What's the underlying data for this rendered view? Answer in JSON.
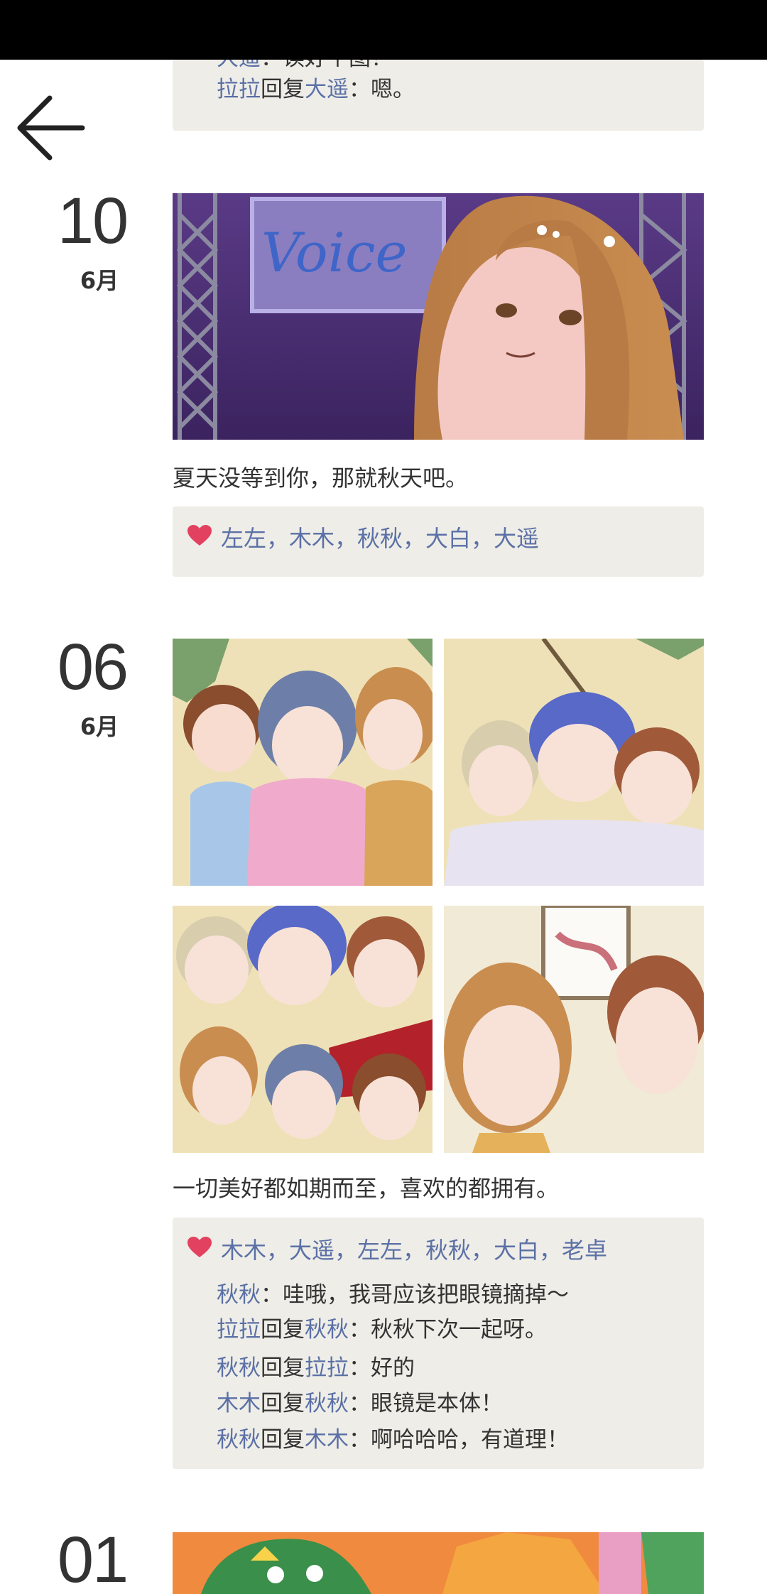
{
  "status_bar": {},
  "nav": {
    "back_icon": "arrow-left-icon"
  },
  "prev_post": {
    "partial_comment": {
      "name": "大遥",
      "rest": "：读好个图！"
    },
    "reply": {
      "from": "拉拉",
      "verb": "回复",
      "to": "大遥",
      "text": "：嗯。"
    }
  },
  "posts": [
    {
      "day": "10",
      "month": "6月",
      "caption": "夏天没等到你，那就秋天吧。",
      "likes": "左左，木木，秋秋，大白，大遥",
      "photos": [
        {
          "sign_text": "Voice"
        }
      ]
    },
    {
      "day": "06",
      "month": "6月",
      "caption": "一切美好都如期而至，喜欢的都拥有。",
      "likes": "木木，大遥，左左，秋秋，大白，老卓",
      "comments": [
        {
          "from": "秋秋",
          "verb": "",
          "to": "",
          "text": "：哇哦，我哥应该把眼镜摘掉～"
        },
        {
          "from": "拉拉",
          "verb": "回复",
          "to": "秋秋",
          "text": "：秋秋下次一起呀。"
        },
        {
          "from": "秋秋",
          "verb": "回复",
          "to": "拉拉",
          "text": "：好的"
        },
        {
          "from": "木木",
          "verb": "回复",
          "to": "秋秋",
          "text": "：眼镜是本体！"
        },
        {
          "from": "秋秋",
          "verb": "回复",
          "to": "木木",
          "text": "：啊哈哈哈，有道理！"
        }
      ]
    },
    {
      "day": "01"
    }
  ],
  "colors": {
    "name_link": "#5b70a6",
    "heart": "#e2415f",
    "comment_bg": "#eeede7"
  }
}
